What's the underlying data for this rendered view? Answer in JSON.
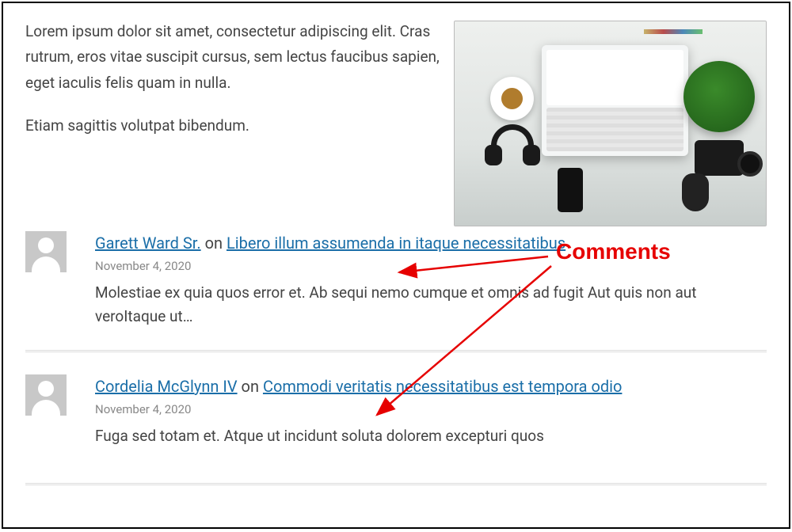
{
  "intro": {
    "p1": "Lorem ipsum dolor sit amet, consectetur adipiscing elit. Cras rutrum, eros vitae suscipit cursus, sem lectus faucibus sapien, eget iaculis felis quam in nulla.",
    "p2": "Etiam sagittis volutpat bibendum."
  },
  "image_alt": "Flat-lay desk with laptop, headphones, coffee, plant, camera and mouse",
  "annotation": {
    "label": "Comments"
  },
  "comments": [
    {
      "author": "Garett Ward Sr.",
      "on": " on ",
      "post": "Libero illum assumenda in itaque necessitatibus",
      "date": "November 4, 2020",
      "text": "Molestiae ex quia quos error et. Ab sequi nemo cumque et omnis ad fugit Aut quis non aut veroItaque ut…"
    },
    {
      "author": "Cordelia McGlynn IV",
      "on": " on ",
      "post": "Commodi veritatis necessitatibus est tempora odio",
      "date": "November 4, 2020",
      "text": "Fuga sed totam et. Atque ut incidunt soluta dolorem excepturi quos"
    }
  ]
}
